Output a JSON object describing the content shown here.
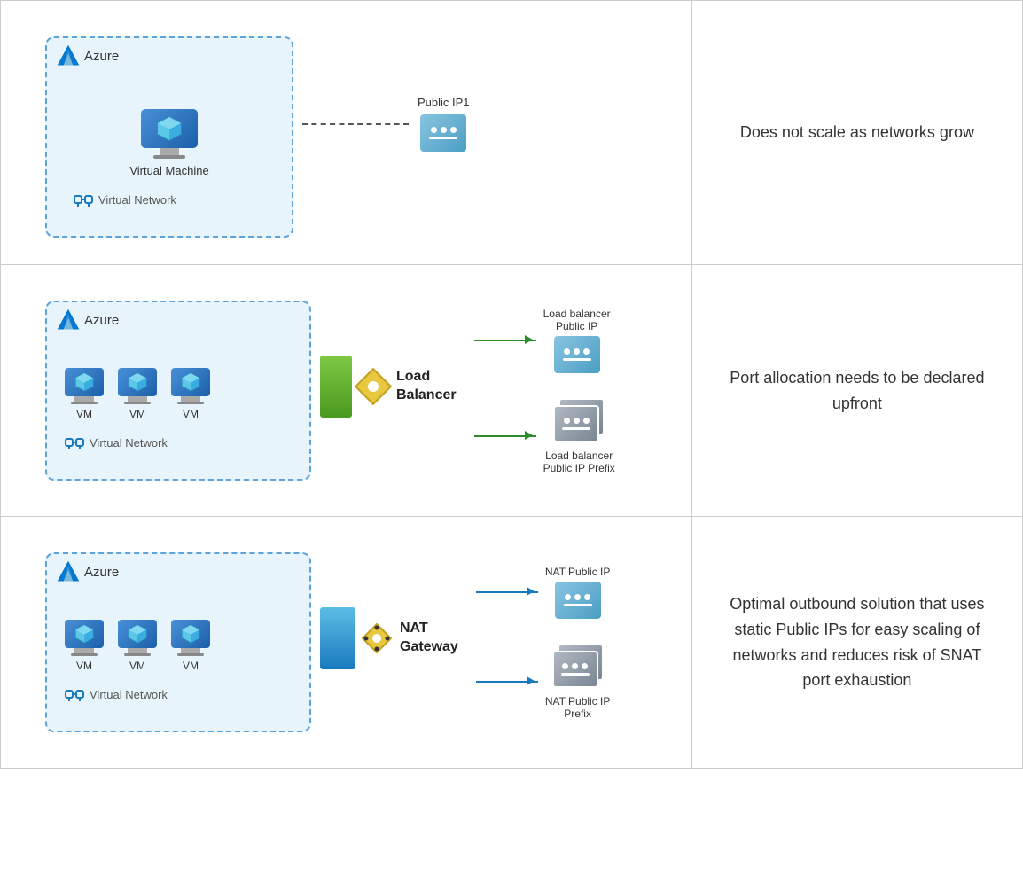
{
  "rows": [
    {
      "id": "row1",
      "azure_label": "Azure",
      "vm_label": "Virtual Machine",
      "vnet_label": "Virtual Network",
      "public_ip_label": "Public IP1",
      "description": "Does not scale as networks grow"
    },
    {
      "id": "row2",
      "azure_label": "Azure",
      "vm_labels": [
        "VM",
        "VM",
        "VM"
      ],
      "vnet_label": "Virtual Network",
      "gateway_label": "Load\nBalancer",
      "ip_label1": "Load balancer\nPublic IP",
      "ip_label2": "Load balancer\nPublic IP Prefix",
      "description": "Port allocation needs to be declared upfront"
    },
    {
      "id": "row3",
      "azure_label": "Azure",
      "vm_labels": [
        "VM",
        "VM",
        "VM"
      ],
      "vnet_label": "Virtual Network",
      "gateway_label": "NAT\nGateway",
      "ip_label1": "NAT Public IP",
      "ip_label2": "NAT Public IP\nPrefix",
      "description": "Optimal outbound solution that uses static Public IPs for easy scaling of networks and reduces risk of SNAT port exhaustion"
    }
  ]
}
